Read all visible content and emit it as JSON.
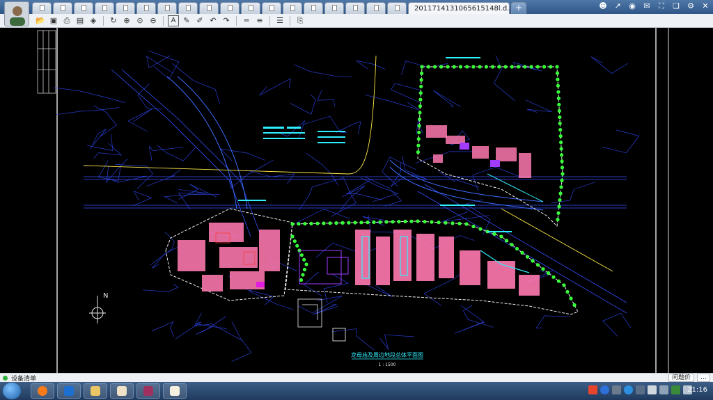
{
  "app": {
    "active_tab_title": "2011714131065615148l.d...",
    "active_tab_close": "×",
    "new_tab_label": "+",
    "closed_tab_count": 18
  },
  "toolbar": {
    "icons": [
      "open-icon",
      "save-icon",
      "print-icon",
      "pdf-icon",
      "lock-icon",
      "rotate-icon",
      "zoom-in-icon",
      "zoom-window-icon",
      "zoom-out-icon",
      "text-icon",
      "pencil-icon",
      "highlighter-icon",
      "undo-icon",
      "redo-icon",
      "measure-icon",
      "layer-lines-icon",
      "layers-icon",
      "export-icon"
    ],
    "text_tool_glyph": "A"
  },
  "drawing": {
    "title": "龙母庙及周边地段总体平面图",
    "north_label": "N",
    "scale_text": "1 : 1500"
  },
  "statusbar": {
    "text": "设备清单",
    "right_label": "问题价",
    "comment_glyph": "…"
  },
  "taskbar": {
    "clock": "21:16"
  },
  "colors": {
    "tab_bar": "#3f6798",
    "toolbar_bg": "#eef1f5",
    "canvas_bg": "#000000",
    "cad_blue": "#2a3fd4",
    "cad_green": "#39ff3a",
    "cad_pink": "#ff79b0",
    "cad_cyan": "#2ff0ff",
    "cad_yellow": "#ffe84a"
  }
}
